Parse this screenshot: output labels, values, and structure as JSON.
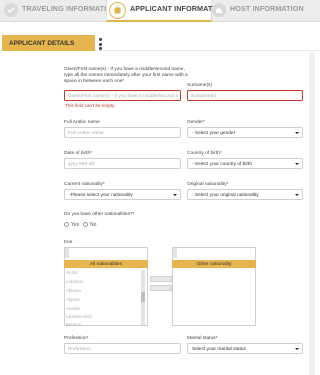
{
  "tabs": [
    {
      "label": "TRAVELING INFORMATION"
    },
    {
      "label": "APPLICANT INFORMATION"
    },
    {
      "label": "HOST INFORMATION"
    }
  ],
  "section": {
    "title": "APPLICANT DETAILS"
  },
  "fields": {
    "given_name": {
      "label": "Given/First name(s) - If you have a middle/second name, type all the names immediately after your first name with a space in between each one*",
      "placeholder": "Given/First name(s) - If you have a middle/second n",
      "error": "This field can't be empty"
    },
    "surname": {
      "label": "Surname(s)",
      "placeholder": "Surname(s)"
    },
    "arabic_name": {
      "label": "Full Arabic name",
      "placeholder": "Full Arabic name"
    },
    "gender": {
      "label": "Gender*",
      "value": "- Select your gender"
    },
    "dob": {
      "label": "Date of birth*",
      "placeholder": "yyyy-MM-dd"
    },
    "country_birth": {
      "label": "Country of birth*",
      "value": "- Select your country of birth"
    },
    "current_nationality": {
      "label": "Current nationality*",
      "value": "-Please select your nationality"
    },
    "original_nationality": {
      "label": "Original nationality*",
      "value": "- Select your original nationality"
    },
    "other_nationalities": {
      "label": "Do you have other nationalities?*",
      "yes": "Yes",
      "no": "No"
    },
    "true_label": "true",
    "all_nationalities": {
      "title": "All nationalities",
      "items": [
        "Aruba",
        "Lebanon",
        "Albania",
        "Algeria",
        "Austria",
        "Liechtenstein",
        "Belarus"
      ]
    },
    "other_nationality": {
      "title": "Other nationality"
    },
    "profession": {
      "label": "Profession*",
      "placeholder": "Profession"
    },
    "marital": {
      "label": "Marital status*",
      "value": "Select your marital status"
    }
  }
}
